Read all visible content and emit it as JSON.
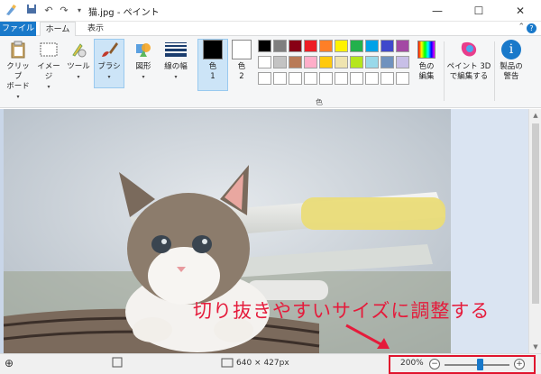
{
  "window": {
    "title": "猫.jpg - ペイント",
    "minimize": "—",
    "maximize": "☐",
    "close": "✕"
  },
  "quick_access": {
    "app_icon": "paint-brush-icon",
    "save_icon": "save-icon",
    "undo_icon": "undo-icon",
    "redo_icon": "redo-icon",
    "customize": "▾"
  },
  "tabs": [
    {
      "label": "ファイル",
      "active": false
    },
    {
      "label": "ホーム",
      "active": true
    },
    {
      "label": "表示",
      "active": false
    }
  ],
  "ribbon": {
    "clipboard": "クリップ\nボード",
    "image": "イメージ",
    "tools": "ツール",
    "brush": "ブラシ",
    "shapes": "図形",
    "line_width": "線の幅",
    "color1": "色\n1",
    "color2": "色\n2",
    "colors_group": "色",
    "edit_colors": "色の\n編集",
    "paint3d": "ペイント 3D\nで編集する",
    "product_alert": "製品の\n警告",
    "color1_value": "#000000",
    "color2_value": "#ffffff",
    "palette_row1": [
      "#000000",
      "#7f7f7f",
      "#880015",
      "#ed1c24",
      "#ff7f27",
      "#fff200",
      "#22b14c",
      "#00a2e8",
      "#3f48cc",
      "#a349a4"
    ],
    "palette_row2": [
      "#ffffff",
      "#c3c3c3",
      "#b97a57",
      "#ffaec9",
      "#ffc90e",
      "#efe4b0",
      "#b5e61d",
      "#99d9ea",
      "#7092be",
      "#c8bfe7"
    ],
    "palette_row3": [
      "#ffffff",
      "#ffffff",
      "#ffffff",
      "#ffffff",
      "#ffffff",
      "#ffffff",
      "#ffffff",
      "#ffffff",
      "#ffffff",
      "#ffffff"
    ]
  },
  "annotation": "切り抜きやすいサイズに調整する",
  "status": {
    "image_size": "640 × 427px",
    "zoom": "200%",
    "zoom_level": 0.5
  }
}
